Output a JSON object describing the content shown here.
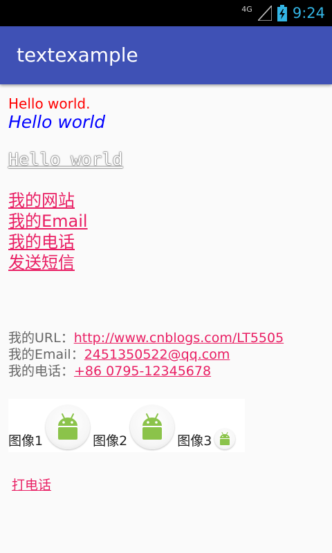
{
  "status_bar": {
    "network": "4G",
    "time": "9:24"
  },
  "app_bar": {
    "title": "textexample"
  },
  "content": {
    "hello_red": "Hello world.",
    "hello_italic": "Hello world",
    "hello_outlined": "Hello world",
    "links": [
      "我的网站",
      "我的Email",
      "我的电话",
      "发送短信"
    ],
    "info": {
      "url_label": "我的URL：",
      "url_value": "http://www.cnblogs.com/LT5505",
      "email_label": "我的Email：",
      "email_value": "2451350522@qq.com",
      "phone_label": "我的电话：",
      "phone_value": "+86 0795-12345678"
    },
    "images": [
      {
        "label": "图像1",
        "icon": "android-icon"
      },
      {
        "label": "图像2",
        "icon": "android-icon"
      },
      {
        "label": "图像3",
        "icon": "android-icon"
      }
    ],
    "call_button": "打电话"
  },
  "colors": {
    "app_bar": "#3f51b5",
    "link": "#e91e63",
    "red_text": "#ff0000",
    "blue_text": "#0000ff",
    "clock": "#33b5e5",
    "android_green": "#8bc34a"
  }
}
